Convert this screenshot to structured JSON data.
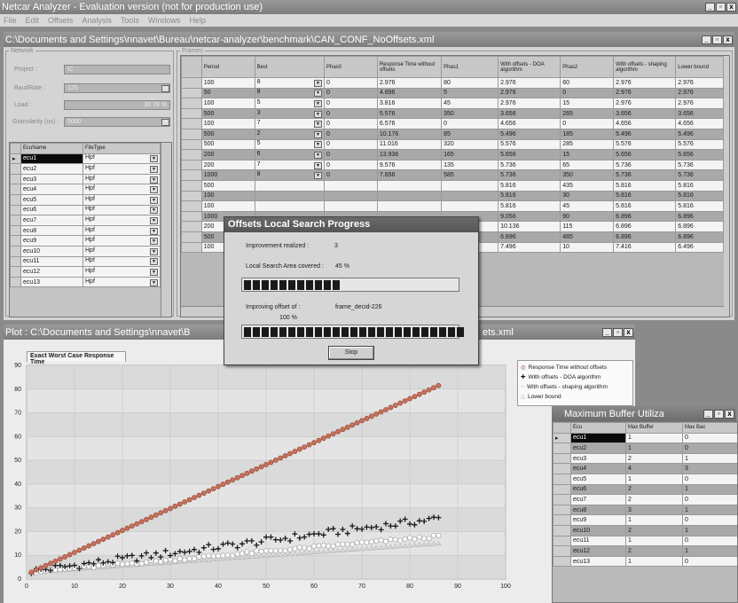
{
  "app": {
    "title": "Netcar Analyzer - Evaluation version (not for production use)",
    "menu": [
      "File",
      "Edit",
      "Offsets",
      "Analysis",
      "Tools",
      "Windows",
      "Help"
    ]
  },
  "doc_window": {
    "title": "C:\\Documents and Settings\\nnavet\\Bureau\\netcar-analyzer\\benchmark\\CAN_CONF_NoOffsets.xml"
  },
  "network": {
    "group_label": "Network",
    "project_label": "Project :",
    "project_value": "IC",
    "baudrate_label": "BaudRate :",
    "baudrate_value": "125",
    "load_label": "Load :",
    "load_value": "30.78 %",
    "granularity_label": "Granularity (us) :",
    "granularity_value": "5000",
    "ecu_columns": [
      "EcuName",
      "FileType"
    ],
    "ecus": [
      {
        "name": "ecu1",
        "type": "Hpf"
      },
      {
        "name": "ecu2",
        "type": "Hpf"
      },
      {
        "name": "ecu3",
        "type": "Hpf"
      },
      {
        "name": "ecu4",
        "type": "Hpf"
      },
      {
        "name": "ecu5",
        "type": "Hpf"
      },
      {
        "name": "ecu6",
        "type": "Hpf"
      },
      {
        "name": "ecu7",
        "type": "Hpf"
      },
      {
        "name": "ecu8",
        "type": "Hpf"
      },
      {
        "name": "ecu9",
        "type": "Hpf"
      },
      {
        "name": "ecu10",
        "type": "Hpf"
      },
      {
        "name": "ecu11",
        "type": "Hpf"
      },
      {
        "name": "ecu12",
        "type": "Hpf"
      },
      {
        "name": "ecu13",
        "type": "Hpf"
      }
    ]
  },
  "frames": {
    "group_label": "Frames",
    "columns": [
      "Period",
      "Best",
      "Phas0",
      "Response Time without offsets",
      "Phas1",
      "With offsets - DOA algorithm",
      "Phas2",
      "With offsets - shaping algorithm",
      "Lower bound"
    ],
    "rows": [
      [
        "100",
        "8",
        "0",
        "2.976",
        "80",
        "2.976",
        "60",
        "2.976",
        "2.976"
      ],
      [
        "50",
        "8",
        "0",
        "4.896",
        "5",
        "2.976",
        "0",
        "2.976",
        "2.976"
      ],
      [
        "100",
        "5",
        "0",
        "3.816",
        "45",
        "2.976",
        "15",
        "2.976",
        "2.976"
      ],
      [
        "500",
        "3",
        "0",
        "5.576",
        "350",
        "3.656",
        "265",
        "3.656",
        "3.656"
      ],
      [
        "100",
        "7",
        "0",
        "6.576",
        "0",
        "4.656",
        "0",
        "4.656",
        "4.656"
      ],
      [
        "500",
        "2",
        "0",
        "10.176",
        "85",
        "5.496",
        "185",
        "5.496",
        "5.496"
      ],
      [
        "500",
        "5",
        "0",
        "11.016",
        "320",
        "5.576",
        "285",
        "5.576",
        "5.576"
      ],
      [
        "200",
        "6",
        "0",
        "13.936",
        "165",
        "5.656",
        "15",
        "5.656",
        "5.656"
      ],
      [
        "200",
        "7",
        "0",
        "9.576",
        "135",
        "5.736",
        "65",
        "5.736",
        "5.736"
      ],
      [
        "1000",
        "8",
        "0",
        "7.656",
        "585",
        "5.736",
        "350",
        "5.736",
        "5.736"
      ],
      [
        "500",
        "",
        "",
        "",
        "",
        "5.816",
        "435",
        "5.816",
        "5.816"
      ],
      [
        "100",
        "",
        "",
        "",
        "",
        "5.816",
        "30",
        "5.816",
        "5.816"
      ],
      [
        "100",
        "",
        "",
        "",
        "",
        "5.816",
        "45",
        "5.816",
        "5.816"
      ],
      [
        "1000",
        "",
        "",
        "",
        "",
        "9.056",
        "90",
        "6.896",
        "6.896"
      ],
      [
        "200",
        "",
        "",
        "",
        "",
        "10.136",
        "115",
        "6.896",
        "6.896"
      ],
      [
        "500",
        "",
        "",
        "",
        "",
        "6.896",
        "485",
        "6.896",
        "6.896"
      ],
      [
        "100",
        "",
        "",
        "",
        "",
        "7.496",
        "10",
        "7.416",
        "6.496"
      ]
    ]
  },
  "progress_dialog": {
    "title": "Offsets Local Search Progress",
    "improvement_label": "Improvement realized :",
    "improvement_value": "3",
    "area_label": "Local Search Area covered :",
    "area_value": "45 %",
    "area_progress": 0.45,
    "improving_label": "Improving offset of :",
    "improving_value": "frame_decid-226",
    "improving_percent": "100 %",
    "improving_progress": 1.0,
    "stop_label": "Stop"
  },
  "plot_window": {
    "title_left": "Plot : C:\\Documents and Settings\\nnavet\\B",
    "title_right": "ets.xml",
    "tab_label": "Exact Worst Case Response Time"
  },
  "buffer_window": {
    "title": "Maximum Buffer Utiliza",
    "columns": [
      "Ecu",
      "Max Buffer",
      "Max Bac"
    ],
    "rows": [
      [
        "ecu1",
        "1",
        "0"
      ],
      [
        "ecu2",
        "1",
        "0"
      ],
      [
        "ecu3",
        "2",
        "1"
      ],
      [
        "ecu4",
        "4",
        "3"
      ],
      [
        "ecu5",
        "1",
        "0"
      ],
      [
        "ecu6",
        "2",
        "1"
      ],
      [
        "ecu7",
        "2",
        "0"
      ],
      [
        "ecu8",
        "3",
        "1"
      ],
      [
        "ecu9",
        "1",
        "0"
      ],
      [
        "ecu10",
        "2",
        "1"
      ],
      [
        "ecu11",
        "1",
        "0"
      ],
      [
        "ecu12",
        "2",
        "1"
      ],
      [
        "ecu13",
        "1",
        "0"
      ]
    ]
  },
  "chart_data": {
    "type": "scatter",
    "title": "Exact Worst Case Response Time",
    "xlim": [
      0,
      100
    ],
    "ylim": [
      0,
      90
    ],
    "xticks": [
      0,
      10,
      20,
      30,
      40,
      50,
      60,
      70,
      80,
      90,
      100
    ],
    "yticks": [
      0,
      10,
      20,
      30,
      40,
      50,
      60,
      70,
      80,
      90
    ],
    "grid": true,
    "legend_position": "top-right",
    "series": [
      {
        "name": "Response Time without offsets",
        "marker": "circle",
        "color": "#c9705a",
        "x_start": 1,
        "x_end": 86,
        "y_start": 2.9,
        "y_end": 81.5
      },
      {
        "name": "With offsets - DOA algorithm",
        "marker": "plus",
        "color": "#1a1a1a",
        "x_start": 1,
        "x_end": 86,
        "y_start": 2.9,
        "y_end": 25
      },
      {
        "name": "With offsets - shaping algorithm",
        "marker": "circle",
        "color": "#ffffff",
        "x_start": 1,
        "x_end": 86,
        "y_start": 2.9,
        "y_end": 18
      },
      {
        "name": "Lower bound",
        "marker": "triangle",
        "color": "#d8d8d8",
        "x_start": 1,
        "x_end": 86,
        "y_start": 2.9,
        "y_end": 15
      }
    ]
  }
}
